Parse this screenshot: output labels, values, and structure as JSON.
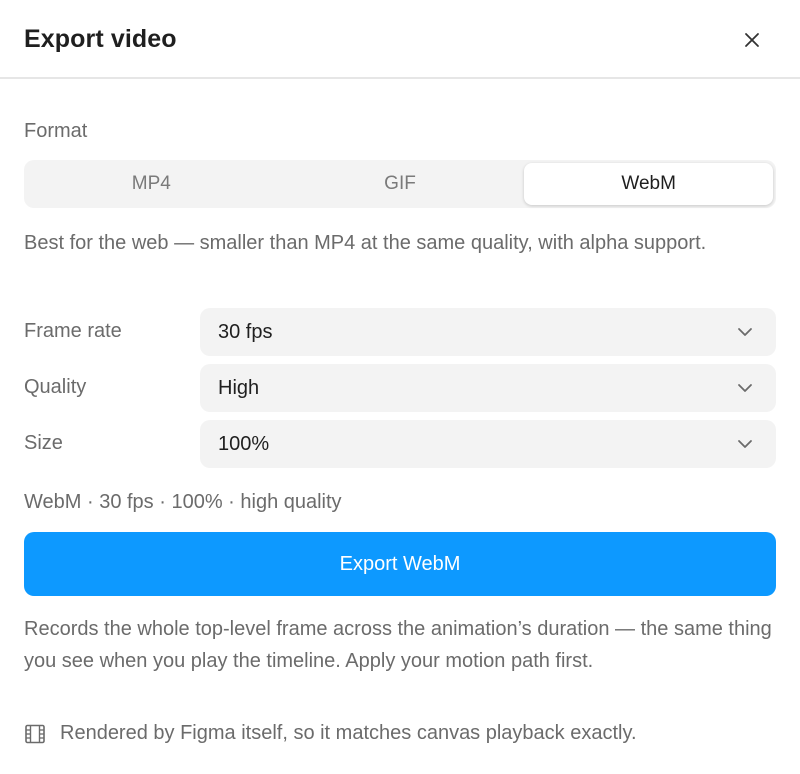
{
  "dialog": {
    "title": "Export video",
    "close_icon": "close-icon"
  },
  "format": {
    "label": "Format",
    "options": [
      "MP4",
      "GIF",
      "WebM"
    ],
    "selected": "WebM",
    "description": "Best for the web — smaller than MP4 at the same quality, with alpha support."
  },
  "settings": {
    "frame_rate": {
      "label": "Frame rate",
      "value": "30 fps"
    },
    "quality": {
      "label": "Quality",
      "value": "High"
    },
    "size": {
      "label": "Size",
      "value": "100%"
    }
  },
  "summary": "WebM · 30 fps · 100% · high quality",
  "export_button": {
    "label": "Export WebM",
    "color": "#0d99ff"
  },
  "note": "Records the whole top-level frame across the animation’s duration — the same thing you see when you play the timeline. Apply your motion path first.",
  "footer": {
    "icon": "film-icon",
    "text": "Rendered by Figma itself, so it matches canvas playback exactly."
  }
}
